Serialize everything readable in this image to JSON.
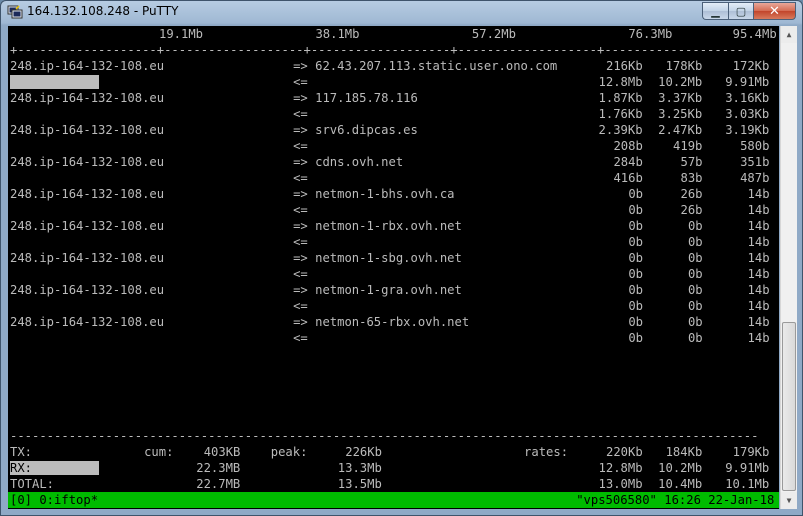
{
  "window": {
    "title": "164.132.108.248 - PuTTY",
    "min_glyph": "▁",
    "max_glyph": "▢",
    "close_glyph": "✕"
  },
  "colors": {
    "terminal_bg": "#000000",
    "terminal_fg": "#bbbbbb",
    "status_bar": "#00bb00"
  },
  "scale": {
    "marks": [
      "19.1Mb",
      "38.1Mb",
      "57.2Mb",
      "76.3Mb",
      "95.4Mb"
    ],
    "ruler": "+-------------------+-------------------+-------------------+-------------------+-------------------"
  },
  "connections": [
    {
      "host": "248.ip-164-132-108.eu",
      "remote": "62.43.207.113.static.user.ono.com",
      "tx": [
        "216Kb",
        "178Kb",
        "172Kb"
      ],
      "rx": [
        "12.8Mb",
        "10.2Mb",
        "9.91Mb"
      ]
    },
    {
      "host": "248.ip-164-132-108.eu",
      "remote": "117.185.78.116",
      "tx": [
        "1.87Kb",
        "3.37Kb",
        "3.16Kb"
      ],
      "rx": [
        "1.76Kb",
        "3.25Kb",
        "3.03Kb"
      ]
    },
    {
      "host": "248.ip-164-132-108.eu",
      "remote": "srv6.dipcas.es",
      "tx": [
        "2.39Kb",
        "2.47Kb",
        "3.19Kb"
      ],
      "rx": [
        "208b",
        "419b",
        "580b"
      ]
    },
    {
      "host": "248.ip-164-132-108.eu",
      "remote": "cdns.ovh.net",
      "tx": [
        "284b",
        "57b",
        "351b"
      ],
      "rx": [
        "416b",
        "83b",
        "487b"
      ]
    },
    {
      "host": "248.ip-164-132-108.eu",
      "remote": "netmon-1-bhs.ovh.ca",
      "tx": [
        "0b",
        "26b",
        "14b"
      ],
      "rx": [
        "0b",
        "26b",
        "14b"
      ]
    },
    {
      "host": "248.ip-164-132-108.eu",
      "remote": "netmon-1-rbx.ovh.net",
      "tx": [
        "0b",
        "0b",
        "14b"
      ],
      "rx": [
        "0b",
        "0b",
        "14b"
      ]
    },
    {
      "host": "248.ip-164-132-108.eu",
      "remote": "netmon-1-sbg.ovh.net",
      "tx": [
        "0b",
        "0b",
        "14b"
      ],
      "rx": [
        "0b",
        "0b",
        "14b"
      ]
    },
    {
      "host": "248.ip-164-132-108.eu",
      "remote": "netmon-1-gra.ovh.net",
      "tx": [
        "0b",
        "0b",
        "14b"
      ],
      "rx": [
        "0b",
        "0b",
        "14b"
      ]
    },
    {
      "host": "248.ip-164-132-108.eu",
      "remote": "netmon-65-rbx.ovh.net",
      "tx": [
        "0b",
        "0b",
        "14b"
      ],
      "rx": [
        "0b",
        "0b",
        "14b"
      ]
    }
  ],
  "arrows": {
    "out": "=>",
    "in": "<="
  },
  "divider": "------------------------------------------------------------------------------------------------------",
  "totals": {
    "tx": {
      "label": "TX:",
      "cum_label": "cum:",
      "cum": "403KB",
      "peak_label": "peak:",
      "peak": "226Kb",
      "rates_label": "rates:",
      "rates": [
        "220Kb",
        "184Kb",
        "179Kb"
      ]
    },
    "rx": {
      "label": "RX:",
      "cum": "22.3MB",
      "peak": "13.3Mb",
      "rates": [
        "12.8Mb",
        "10.2Mb",
        "9.91Mb"
      ]
    },
    "total": {
      "label": "TOTAL:",
      "cum": "22.7MB",
      "peak": "13.5Mb",
      "rates": [
        "13.0Mb",
        "10.4Mb",
        "10.1Mb"
      ]
    }
  },
  "status": {
    "left": "[0] 0:iftop*",
    "right": "\"vps506580\" 16:26 22-Jan-18"
  }
}
